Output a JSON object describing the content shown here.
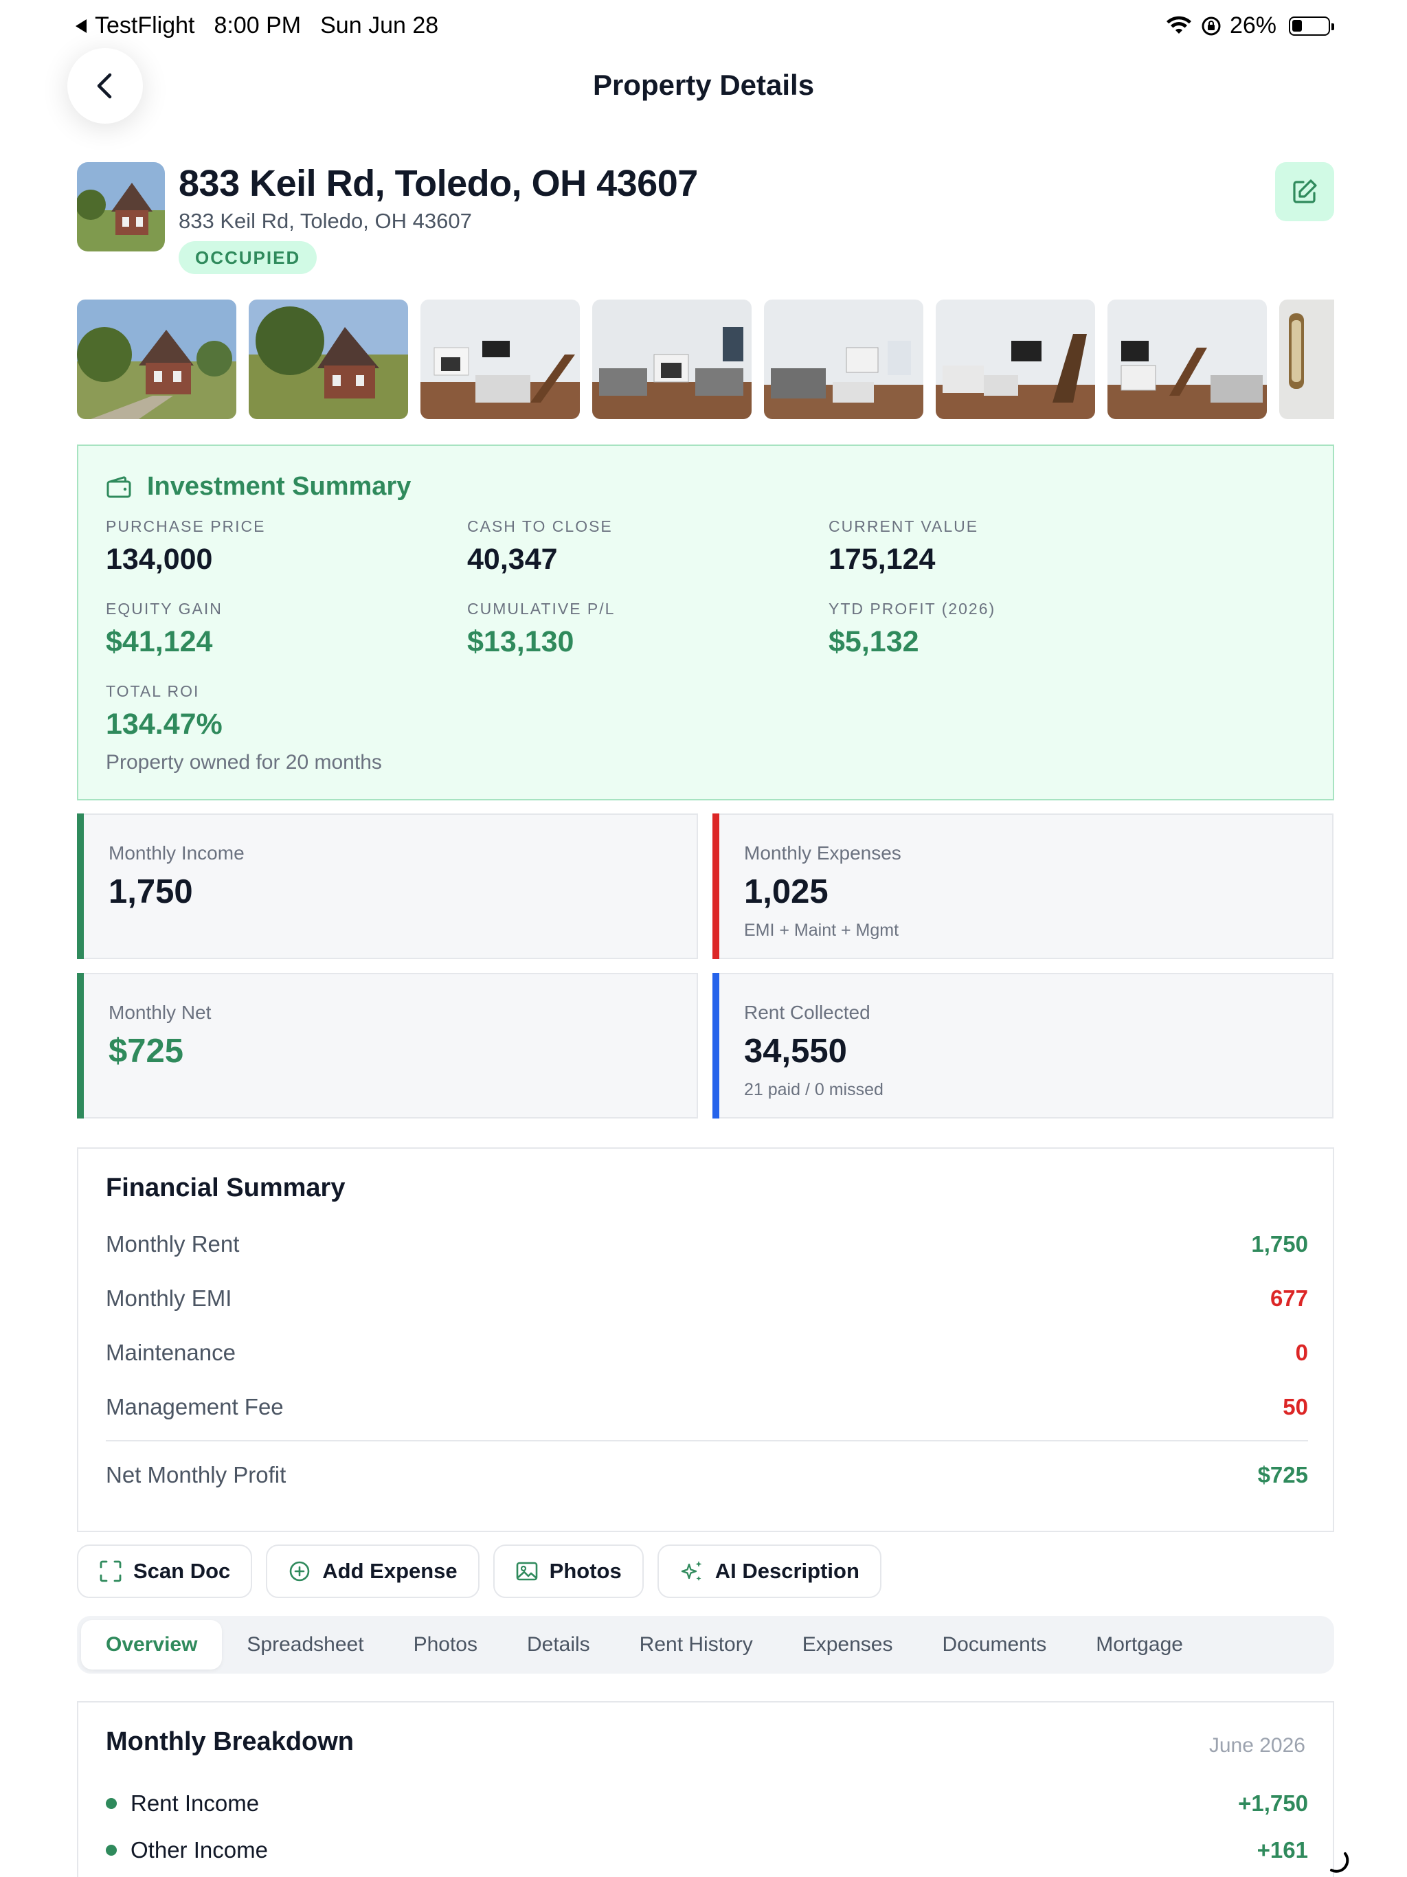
{
  "status_bar": {
    "app": "TestFlight",
    "time": "8:00 PM",
    "date": "Sun Jun 28",
    "battery": "26%"
  },
  "header": {
    "title": "Property Details"
  },
  "property": {
    "title": "833 Keil Rd, Toledo, OH 43607",
    "address": "833 Keil Rd, Toledo, OH 43607",
    "status": "OCCUPIED"
  },
  "gallery": {
    "count_visible": 8
  },
  "investment": {
    "title": "Investment Summary",
    "metrics": [
      {
        "label": "PURCHASE PRICE",
        "value": "134,000"
      },
      {
        "label": "CASH TO CLOSE",
        "value": "40,347"
      },
      {
        "label": "CURRENT VALUE",
        "value": "175,124"
      },
      {
        "label": "EQUITY GAIN",
        "value": "$41,124"
      },
      {
        "label": "CUMULATIVE P/L",
        "value": "$13,130"
      },
      {
        "label": "YTD PROFIT (2026)",
        "value": "$5,132"
      },
      {
        "label": "TOTAL ROI",
        "value": "134.47%"
      }
    ],
    "owned_note": "Property owned for 20 months"
  },
  "kpis": [
    {
      "label": "Monthly Income",
      "value": "1,750",
      "sub": "",
      "accent": "#2f8a5c"
    },
    {
      "label": "Monthly Expenses",
      "value": "1,025",
      "sub": "EMI + Maint + Mgmt",
      "accent": "#dc2626"
    },
    {
      "label": "Monthly Net",
      "value": "$725",
      "sub": "",
      "accent": "#2f8a5c"
    },
    {
      "label": "Rent Collected",
      "value": "34,550",
      "sub": "21 paid / 0 missed",
      "accent": "#2563eb"
    }
  ],
  "financial_summary": {
    "title": "Financial Summary",
    "rows": [
      {
        "label": "Monthly Rent",
        "value": "1,750"
      },
      {
        "label": "Monthly EMI",
        "value": "677"
      },
      {
        "label": "Maintenance",
        "value": "0"
      },
      {
        "label": "Management Fee",
        "value": "50"
      }
    ],
    "net": {
      "label": "Net Monthly Profit",
      "value": "$725"
    }
  },
  "actions": {
    "scan_doc": "Scan Doc",
    "add_expense": "Add Expense",
    "photos": "Photos",
    "ai_description": "AI Description"
  },
  "tabs": [
    "Overview",
    "Spreadsheet",
    "Photos",
    "Details",
    "Rent History",
    "Expenses",
    "Documents",
    "Mortgage"
  ],
  "active_tab": "Overview",
  "breakdown": {
    "title": "Monthly Breakdown",
    "date": "June 2026",
    "rows": [
      {
        "label": "Rent Income",
        "value": "+1,750"
      },
      {
        "label": "Other Income",
        "value": "+161"
      }
    ]
  },
  "colors": {
    "accent_green": "#2f8a5c",
    "expense_red": "#dc2626",
    "rent_blue": "#2563eb"
  }
}
